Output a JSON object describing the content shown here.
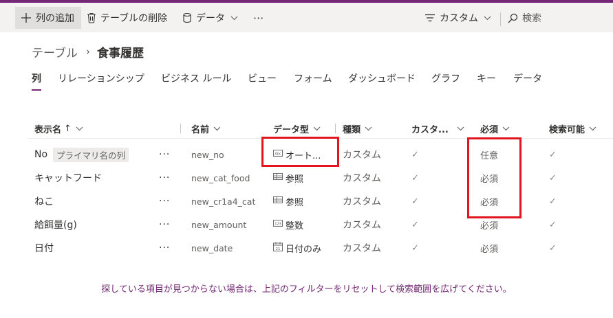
{
  "colors": {
    "accent": "#742774",
    "highlight": "#e2141f",
    "commandbar": "#f3f2f1"
  },
  "commandbar": {
    "add_column": {
      "label": "列の追加",
      "icon": "plus-icon"
    },
    "delete_table": {
      "label": "テーブルの削除",
      "icon": "trash-icon"
    },
    "data": {
      "label": "データ",
      "icon": "database-icon"
    },
    "more": "···",
    "view": {
      "label": "カスタム",
      "icon": "filter-lines-icon"
    },
    "search": {
      "placeholder": "検索",
      "icon": "search-icon"
    }
  },
  "breadcrumb": {
    "root": "テーブル",
    "separator": "›",
    "current": "食事履歴"
  },
  "tabs": [
    {
      "label": "列",
      "selected": true
    },
    {
      "label": "リレーションシップ"
    },
    {
      "label": "ビジネス ルール"
    },
    {
      "label": "ビュー"
    },
    {
      "label": "フォーム"
    },
    {
      "label": "ダッシュボード"
    },
    {
      "label": "グラフ"
    },
    {
      "label": "キー"
    },
    {
      "label": "データ"
    }
  ],
  "table": {
    "headers": {
      "display_name": "表示名",
      "sort_arrow": "↑",
      "name": "名前",
      "data_type": "データ型",
      "kind": "種類",
      "customizable": "カスタ...",
      "required": "必須",
      "searchable": "検索可能"
    },
    "rows": [
      {
        "display_name": "No",
        "badge": "プライマリ名の列",
        "more": "···",
        "name": "new_no",
        "type_icon": "text-type-icon",
        "type": "オート...",
        "kind": "カスタム",
        "customizable": "✓",
        "required": "任意",
        "searchable": "✓"
      },
      {
        "display_name": "キャットフード",
        "more": "···",
        "name": "new_cat_food",
        "type_icon": "lookup-table-icon",
        "type": "参照",
        "kind": "カスタム",
        "customizable": "✓",
        "required": "必須",
        "searchable": "✓"
      },
      {
        "display_name": "ねこ",
        "more": "···",
        "name": "new_cr1a4_cat",
        "type_icon": "lookup-table-icon",
        "type": "参照",
        "kind": "カスタム",
        "customizable": "✓",
        "required": "必須",
        "searchable": "✓"
      },
      {
        "display_name": "給餌量(g)",
        "more": "···",
        "name": "new_amount",
        "type_icon": "number-type-icon",
        "type": "整数",
        "kind": "カスタム",
        "customizable": "✓",
        "required": "必須",
        "searchable": "✓"
      },
      {
        "display_name": "日付",
        "more": "···",
        "name": "new_date",
        "type_icon": "calendar-icon",
        "type": "日付のみ",
        "kind": "カスタム",
        "customizable": "✓",
        "required": "必須",
        "searchable": "✓"
      }
    ]
  },
  "footnote": "探している項目が見つからない場合は、上記のフィルターをリセットして検索範囲を広げてください。"
}
